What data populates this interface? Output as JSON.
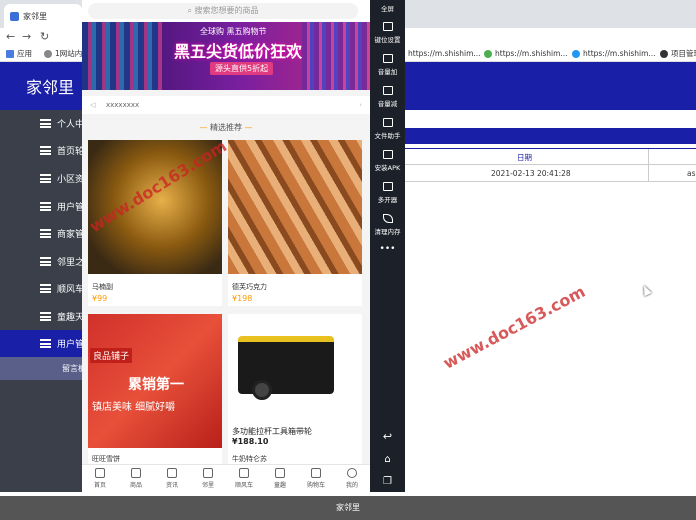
{
  "browser": {
    "tab_title": "家邻里",
    "bookmarks": [
      "应用",
      "1网站内...",
      "https://m.shishim...",
      "https://m.shishim...",
      "https://m.shishim...",
      "项目管理"
    ]
  },
  "admin": {
    "logo": "家邻里",
    "sidebar": [
      "个人中心",
      "首页轮播",
      "小区资讯",
      "用户管理",
      "商家管理",
      "邻里之家",
      "顺风车",
      "童趣天地",
      "用户管理"
    ],
    "sub_item": "留言板",
    "table": {
      "header": "日期",
      "row_date": "2021-02-13 20:41:28",
      "row_extra": "as"
    },
    "footer": "家邻里"
  },
  "phone": {
    "search_placeholder": "搜索您想要的商品",
    "banner": {
      "tag": "全球购  黑五购物节",
      "title": "黑五尖货低价狂欢",
      "sub": "源头直供5折起"
    },
    "notice": "xxxxxxxx",
    "section_title": "精选推荐",
    "products": [
      {
        "name": "马楠副",
        "price": "¥99"
      },
      {
        "name": "德芙巧克力",
        "price": "¥198"
      },
      {
        "name": "旺旺雪饼",
        "price": ""
      },
      {
        "name": "牛奶特仑苏",
        "price": ""
      }
    ],
    "product_overlay": {
      "name": "多功能拉杆工具箱带轮",
      "price": "¥188.10",
      "shop_brand": "良品铺子",
      "shop_slogan1": "累销第一",
      "shop_slogan2": "镇店美味 细腻好嚼"
    },
    "tabs": [
      "首页",
      "商品",
      "资讯",
      "邻里",
      "顺风车",
      "童趣",
      "购物车",
      "我的"
    ]
  },
  "emulator": {
    "buttons": [
      "全屏",
      "键位设置",
      "音量加",
      "音量减",
      "文件助手",
      "安装APK",
      "多开器",
      "清理内存"
    ]
  },
  "watermark": "www.doc163.com",
  "colors": {
    "brand_blue": "#1a1fa8",
    "accent_orange": "#ff9900"
  }
}
